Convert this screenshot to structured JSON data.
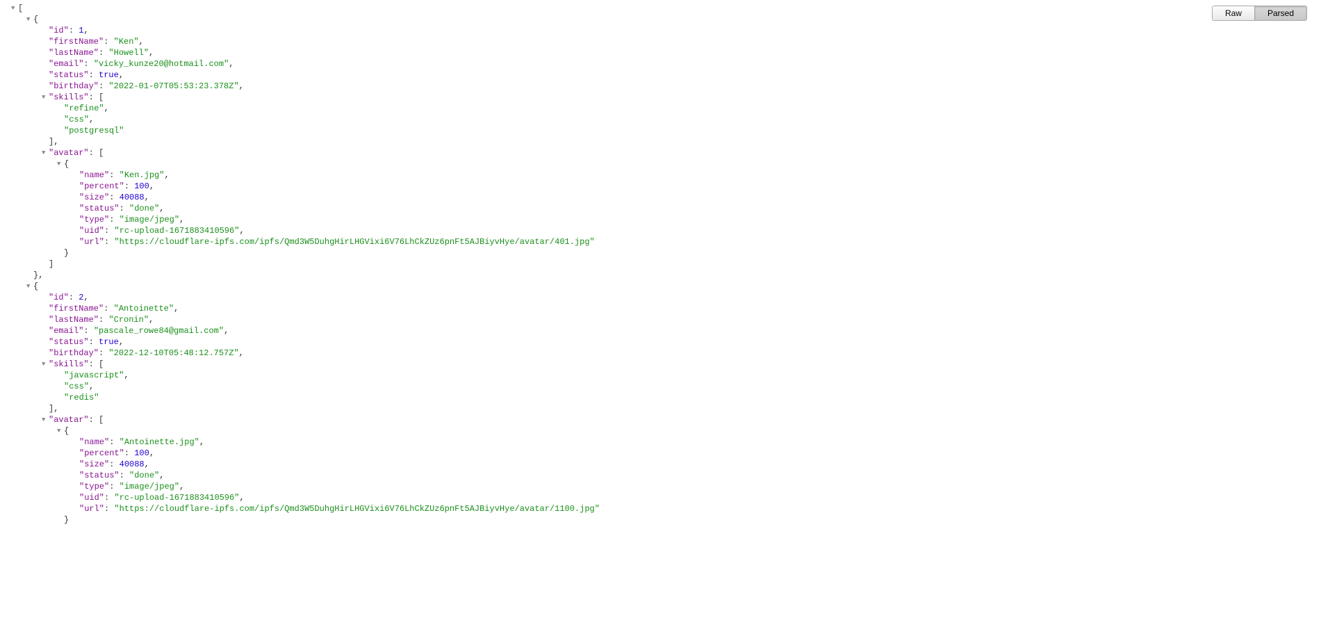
{
  "toolbar": {
    "raw_label": "Raw",
    "parsed_label": "Parsed"
  },
  "items": [
    {
      "id": 1,
      "firstName": "Ken",
      "lastName": "Howell",
      "email": "vicky_kunze20@hotmail.com",
      "status": true,
      "birthday": "2022-01-07T05:53:23.378Z",
      "skills": [
        "refine",
        "css",
        "postgresql"
      ],
      "avatar": [
        {
          "name": "Ken.jpg",
          "percent": 100,
          "size": 40088,
          "status": "done",
          "type": "image/jpeg",
          "uid": "rc-upload-1671883410596",
          "url": "https://cloudflare-ipfs.com/ipfs/Qmd3W5DuhgHirLHGVixi6V76LhCkZUz6pnFt5AJBiyvHye/avatar/401.jpg"
        }
      ]
    },
    {
      "id": 2,
      "firstName": "Antoinette",
      "lastName": "Cronin",
      "email": "pascale_rowe84@gmail.com",
      "status": true,
      "birthday": "2022-12-10T05:48:12.757Z",
      "skills": [
        "javascript",
        "css",
        "redis"
      ],
      "avatar": [
        {
          "name": "Antoinette.jpg",
          "percent": 100,
          "size": 40088,
          "status": "done",
          "type": "image/jpeg",
          "uid": "rc-upload-1671883410596",
          "url": "https://cloudflare-ipfs.com/ipfs/Qmd3W5DuhgHirLHGVixi6V76LhCkZUz6pnFt5AJBiyvHye/avatar/1100.jpg"
        }
      ]
    }
  ]
}
